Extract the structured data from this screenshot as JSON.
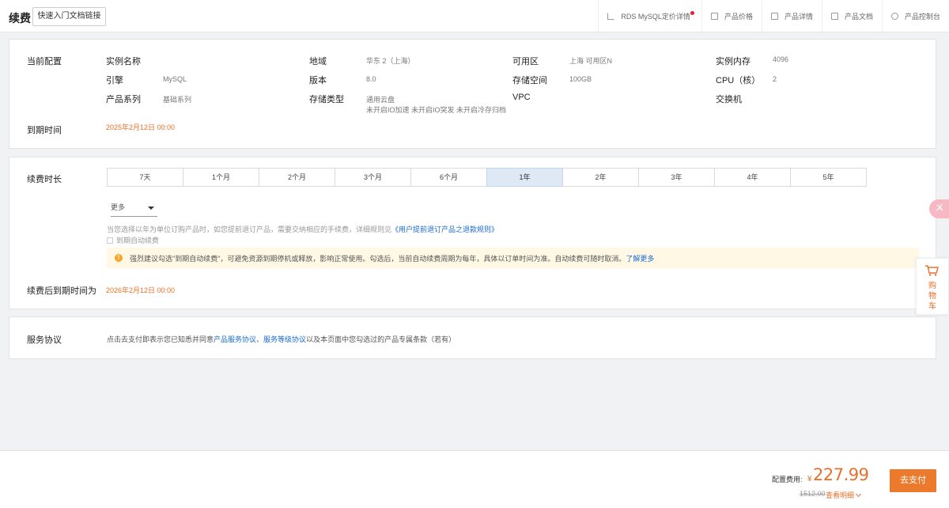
{
  "header": {
    "title": "续费",
    "quick_link_button": "快速入门文档链接",
    "links": [
      {
        "label": "RDS MySQL定价详情",
        "icon": "external-link-icon",
        "has_dot": true
      },
      {
        "label": "产品价格",
        "icon": "price-list-icon"
      },
      {
        "label": "产品详情",
        "icon": "bookmark-icon"
      },
      {
        "label": "产品文档",
        "icon": "document-icon"
      },
      {
        "label": "产品控制台",
        "icon": "console-icon"
      }
    ]
  },
  "config": {
    "section_label": "当前配置",
    "instance_name_label": "实例名称",
    "region_label": "地域",
    "region_value": "华东 2（上海）",
    "zone_label": "可用区",
    "zone_value": "上海 可用区N",
    "memory_label": "实例内存",
    "memory_value": "4096",
    "engine_label": "引擎",
    "engine_value": "MySQL",
    "version_label": "版本",
    "version_value": "8.0",
    "storage_label": "存储空间",
    "storage_value": "100GB",
    "cpu_label": "CPU（核）",
    "cpu_value": "2",
    "series_label": "产品系列",
    "series_value": "基础系列",
    "storage_type_label": "存储类型",
    "storage_type_value": "通用云盘",
    "storage_type_sub": "未开启IO加速 未开启IO突发 未开启冷存归档",
    "vpc_label": "VPC",
    "switch_label": "交换机",
    "expire_label": "到期时间",
    "expire_value": "2025年2月12日 00:00"
  },
  "renew": {
    "section_label": "续费时长",
    "durations": [
      "7天",
      "1个月",
      "2个月",
      "3个月",
      "6个月",
      "1年",
      "2年",
      "3年",
      "4年",
      "5年"
    ],
    "selected_duration": "1年",
    "more_select": "更多",
    "note_prefix": "当您选择以年为单位订购产品时，如您提前退订产品，需要交纳相应的手续费，详细规则见",
    "note_link": "《用户提前退订产品之退款规则》",
    "auto_renew_label": "到期自动续费",
    "warning_text": "强烈建议勾选\"到期自动续费\"，可避免资源到期停机或释放，影响正常使用。勾选后，当前自动续费周期为每年，具体以订单时间为准。自动续费可随时取消。",
    "warning_link": "了解更多",
    "new_expire_label": "续费后到期时间为",
    "new_expire_value": "2026年2月12日 00:00"
  },
  "agreement": {
    "section_label": "服务协议",
    "text_prefix": "点击去支付即表示您已知悉并同意",
    "link1": "产品服务协议",
    "sep": "、",
    "link2": "服务等级协议",
    "text_suffix": "以及本页面中您勾选过的产品专属条款（若有）"
  },
  "footer": {
    "price_label": "配置费用:",
    "currency": "¥",
    "price": "227.99",
    "original_price": "1512.00",
    "detail_link": "查看明细",
    "pay_button": "去支付"
  },
  "float": {
    "cart_label": "购物车",
    "badge": "ㄨ"
  },
  "colors": {
    "accent": "#ec7a2d",
    "link": "#1a6bd0",
    "selected_tab": "#dfe9f6",
    "warning_bg": "#fff8e5"
  }
}
